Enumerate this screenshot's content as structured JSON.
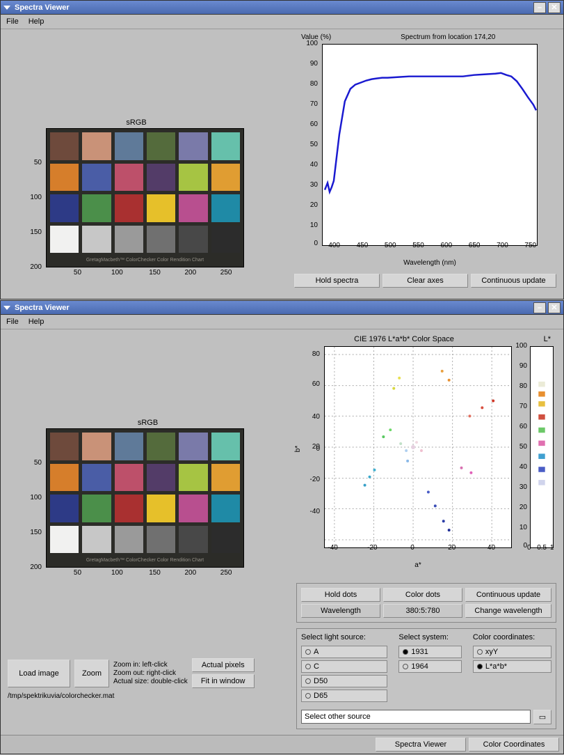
{
  "window_title": "Spectra Viewer",
  "menu": {
    "file": "File",
    "help": "Help"
  },
  "srgb_label": "sRGB",
  "colorchecker_caption": "GretagMacbeth™ ColorChecker Color Rendition Chart",
  "srgb_yticks": [
    "50",
    "100",
    "150",
    "200"
  ],
  "srgb_xticks": [
    "50",
    "100",
    "150",
    "200",
    "250"
  ],
  "colorchecker_colors": [
    "#6e4a3c",
    "#c99278",
    "#5f7a99",
    "#546b3c",
    "#7a7aa9",
    "#66c0ab",
    "#d67e2b",
    "#4a5da6",
    "#bd506a",
    "#533c68",
    "#a6c443",
    "#e09d32",
    "#2d3a86",
    "#4b8f4a",
    "#a93030",
    "#e6c02a",
    "#b84f8f",
    "#1f8aa6",
    "#f1f1f0",
    "#c7c7c7",
    "#9a9a9a",
    "#707070",
    "#484848",
    "#2c2c2c"
  ],
  "top_spectrum": {
    "value_label": "Value (%)",
    "title": "Spectrum from location 174,20",
    "xlabel": "Wavelength (nm)",
    "yticks": [
      "100",
      "90",
      "80",
      "70",
      "60",
      "50",
      "40",
      "30",
      "20",
      "10",
      "0"
    ],
    "xticks": [
      "400",
      "450",
      "500",
      "550",
      "600",
      "650",
      "700",
      "750"
    ]
  },
  "top_buttons": {
    "hold": "Hold spectra",
    "clear": "Clear axes",
    "continuous": "Continuous update"
  },
  "lab_chart": {
    "title": "CIE 1976 L*a*b* Color Space",
    "L_label": "L*",
    "yticks": [
      "80",
      "60",
      "40",
      "20",
      "0",
      "-20",
      "-40"
    ],
    "xticks": [
      "-40",
      "-20",
      "0",
      "20",
      "40"
    ],
    "xlabel": "a*",
    "ylabel": "b*",
    "L_yticks": [
      "100",
      "90",
      "80",
      "70",
      "60",
      "50",
      "40",
      "30",
      "20",
      "10",
      "0"
    ],
    "L_xticks": [
      "0",
      "0.5",
      "1"
    ]
  },
  "mid_buttons": {
    "hold_dots": "Hold dots",
    "color_dots": "Color dots",
    "continuous": "Continuous update",
    "wavelength": "Wavelength",
    "wl_value": "380:5:780",
    "change_wl": "Change wavelength"
  },
  "selectors": {
    "light_source_label": "Select light source:",
    "system_label": "Select system:",
    "coords_label": "Color coordinates:",
    "sources": [
      "A",
      "C",
      "D50",
      "D65"
    ],
    "systems": [
      "1931",
      "1964"
    ],
    "coords": [
      "xyY",
      "L*a*b*"
    ],
    "other_source_label": "Select other source"
  },
  "bottom_left": {
    "load": "Load image",
    "zoom": "Zoom",
    "help1": "Zoom in: left-click",
    "help2": "Zoom out: right-click",
    "help3": "Actual size: double-click",
    "actual_px": "Actual pixels",
    "fit": "Fit in window",
    "path": "/tmp/spektrikuvia/colorchecker.mat"
  },
  "status": {
    "spectra": "Spectra Viewer",
    "color_coord": "Color Coordinates"
  },
  "chart_data": [
    {
      "type": "line",
      "title": "Spectrum from location 174,20",
      "xlabel": "Wavelength (nm)",
      "ylabel": "Value (%)",
      "xlim": [
        380,
        780
      ],
      "ylim": [
        0,
        100
      ],
      "x": [
        380,
        385,
        390,
        395,
        400,
        410,
        420,
        430,
        440,
        450,
        460,
        470,
        480,
        490,
        500,
        520,
        540,
        560,
        580,
        600,
        620,
        640,
        660,
        680,
        700,
        710,
        720,
        730,
        740,
        750,
        760,
        770,
        780
      ],
      "y": [
        28,
        32,
        27,
        30,
        33,
        55,
        72,
        78,
        80,
        81,
        82,
        82,
        83,
        83,
        83,
        84,
        84,
        84,
        84,
        84,
        84,
        84,
        84,
        85,
        85,
        86,
        85,
        84,
        82,
        78,
        74,
        70,
        67
      ]
    },
    {
      "type": "scatter",
      "title": "CIE 1976 L*a*b* Color Space",
      "xlabel": "a*",
      "ylabel": "b*",
      "xlim": [
        -45,
        50
      ],
      "ylim": [
        -45,
        85
      ],
      "note": "dense colored scatter centered near origin with branches toward (20,-40), (40,30), (-25,-15), (-10,65)"
    },
    {
      "type": "scatter",
      "title": "L*",
      "xlabel": "",
      "ylabel": "L*",
      "xlim": [
        0,
        1
      ],
      "ylim": [
        0,
        100
      ],
      "note": "vertical color strip mostly between L=25 and L=80"
    }
  ]
}
